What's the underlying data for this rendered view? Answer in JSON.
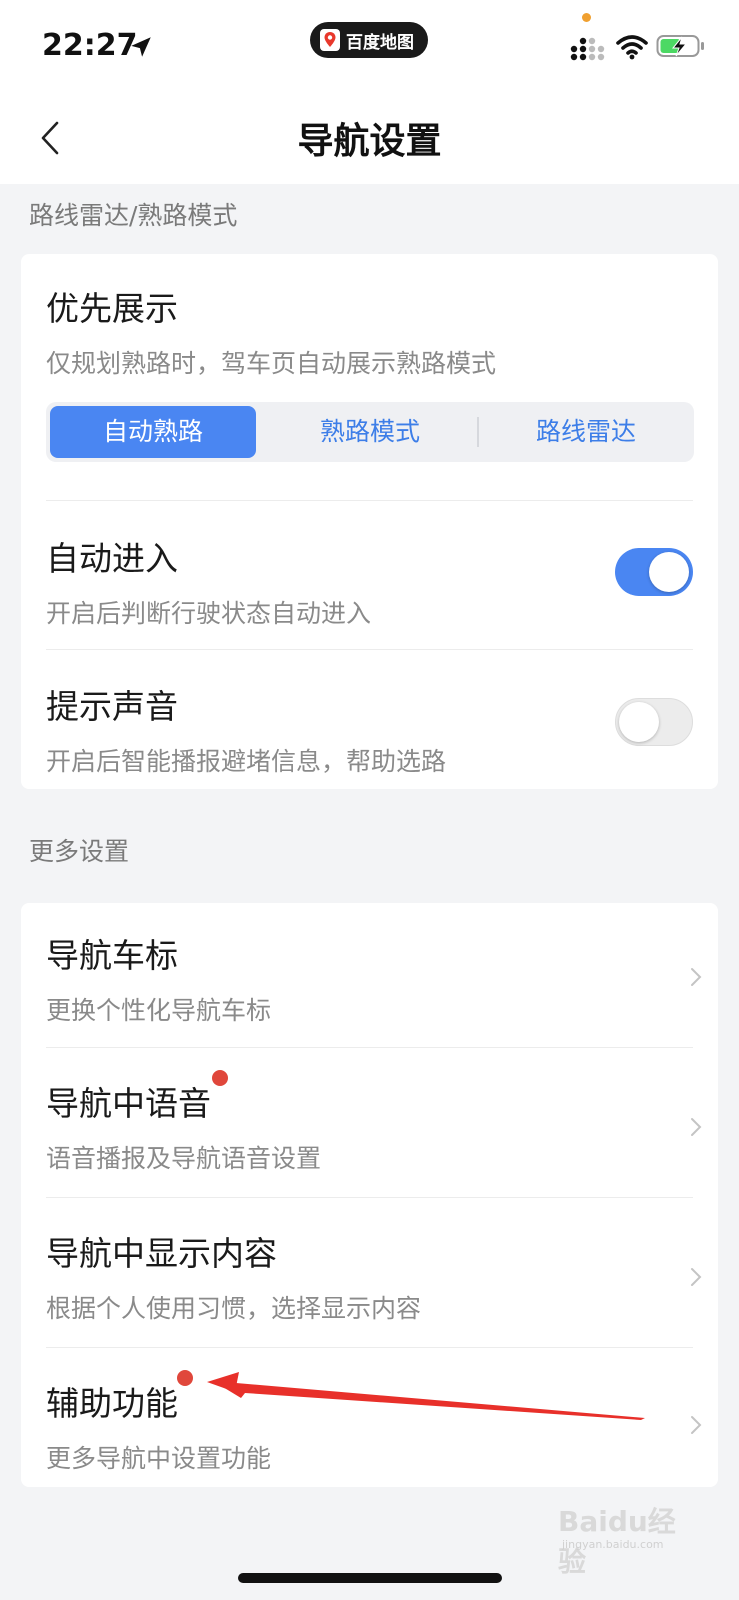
{
  "status_bar": {
    "time": "22:27",
    "app_badge": "百度地图",
    "icons": [
      "location-arrow-icon",
      "signal-icon",
      "wifi-icon",
      "battery-charging-icon"
    ]
  },
  "nav": {
    "title": "导航设置",
    "back_icon": "chevron-left-icon"
  },
  "section1": {
    "label": "路线雷达/熟路模式",
    "priority": {
      "title": "优先展示",
      "subtitle": "仅规划熟路时，驾车页自动展示熟路模式",
      "options": [
        "自动熟路",
        "熟路模式",
        "路线雷达"
      ],
      "selected": "自动熟路"
    },
    "auto_enter": {
      "title": "自动进入",
      "subtitle": "开启后判断行驶状态自动进入",
      "enabled": true
    },
    "sound": {
      "title": "提示声音",
      "subtitle": "开启后智能播报避堵信息，帮助选路",
      "enabled": false
    }
  },
  "section2": {
    "label": "更多设置",
    "items": [
      {
        "title": "导航车标",
        "subtitle": "更换个性化导航车标",
        "badge": false
      },
      {
        "title": "导航中语音",
        "subtitle": "语音播报及导航语音设置",
        "badge": true
      },
      {
        "title": "导航中显示内容",
        "subtitle": "根据个人使用习惯，选择显示内容",
        "badge": false
      },
      {
        "title": "辅助功能",
        "subtitle": "更多导航中设置功能",
        "badge": true
      }
    ]
  },
  "watermark": {
    "text": "Baidu经验",
    "sub": "jingyan.baidu.com"
  },
  "colors": {
    "accent": "#4a86f2",
    "badge": "#e0473b",
    "annotation": "#e8302a"
  }
}
